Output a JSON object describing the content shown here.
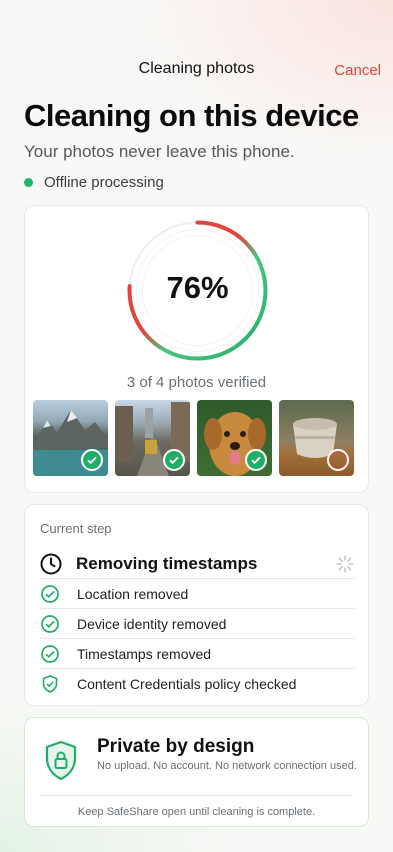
{
  "header": {
    "title": "Cleaning photos",
    "cancel_label": "Cancel"
  },
  "main": {
    "heading": "Cleaning on this device",
    "subtitle": "Your photos never leave this phone.",
    "status": "Offline processing"
  },
  "progress": {
    "percent_label": "76%",
    "percent_value": 0.76,
    "verified_text": "3 of 4 photos verified",
    "photos": [
      {
        "subject": "mountain lake",
        "status": "done"
      },
      {
        "subject": "city street",
        "status": "done"
      },
      {
        "subject": "golden retriever",
        "status": "done"
      },
      {
        "subject": "ceramic cup",
        "status": "pending"
      }
    ]
  },
  "steps": {
    "label": "Current step",
    "current": "Removing timestamps",
    "completed": [
      "Location removed",
      "Device identity removed",
      "Timestamps removed",
      "Content Credentials policy checked"
    ]
  },
  "privacy": {
    "title": "Private by design",
    "description": "No upload. No account. No network connection used.",
    "note": "Keep SafeShare open until cleaning is complete."
  },
  "colors": {
    "accent_green": "#1fae67",
    "accent_red": "#e0443a"
  }
}
